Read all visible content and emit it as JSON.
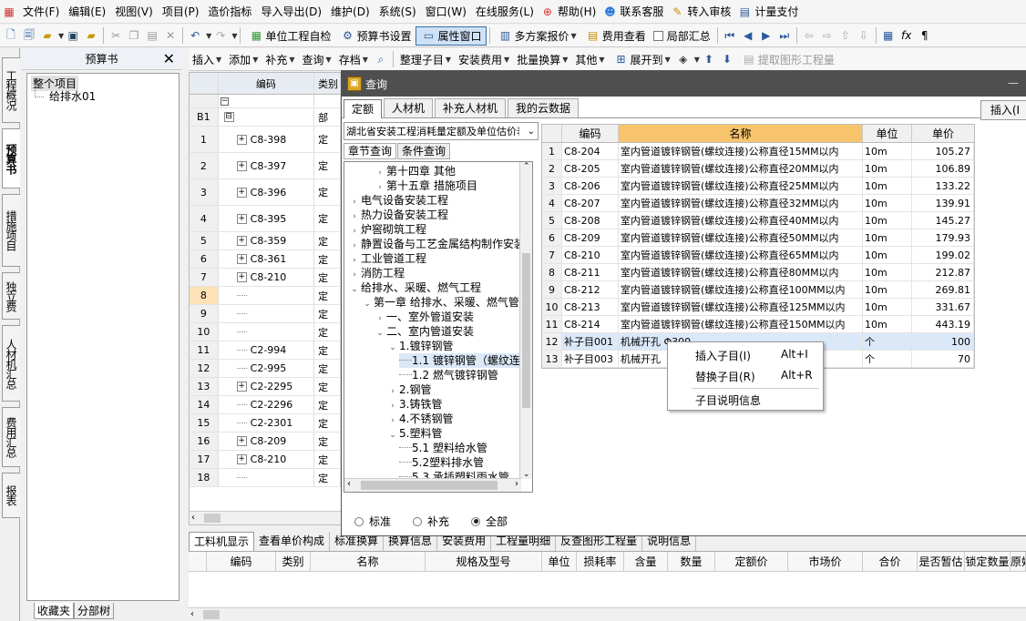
{
  "menu": [
    "文件(F)",
    "编辑(E)",
    "视图(V)",
    "项目(P)",
    "造价指标",
    "导入导出(D)",
    "维护(D)",
    "系统(S)",
    "窗口(W)",
    "在线服务(L)",
    "帮助(H)",
    "联系客服",
    "转入审核",
    "计量支付"
  ],
  "toolbar1": {
    "self_check": "单位工程自检",
    "budget_settings": "预算书设置",
    "property_window": "属性窗口",
    "multi_quote": "多方案报价",
    "fee_view": "费用查看",
    "local_summary": "局部汇总"
  },
  "toolbar2": [
    "插入",
    "添加",
    "补充",
    "查询",
    "存档",
    "整理子目",
    "安装费用",
    "批量换算",
    "其他",
    "展开到",
    "提取图形工程量"
  ],
  "left_tabs": [
    "工程概况",
    "预算书",
    "措施项目",
    "独立费",
    "人材机汇总",
    "费用汇总",
    "报表"
  ],
  "budget_panel": {
    "title": "预算书",
    "close": "✕",
    "root": "整个项目",
    "child": "给排水01",
    "bottom_tabs": [
      "收藏夹",
      "分部树"
    ]
  },
  "grid": {
    "col_code": "编码",
    "col_type": "类别",
    "rows": [
      {
        "no": "B1",
        "exp": "⊟",
        "code": "",
        "type": "部"
      },
      {
        "no": "1",
        "exp": "+",
        "code": "C8-398",
        "type": "定"
      },
      {
        "no": "2",
        "exp": "+",
        "code": "C8-397",
        "type": "定"
      },
      {
        "no": "3",
        "exp": "+",
        "code": "C8-396",
        "type": "定"
      },
      {
        "no": "4",
        "exp": "+",
        "code": "C8-395",
        "type": "定"
      },
      {
        "no": "5",
        "exp": "+",
        "code": "C8-359",
        "type": "定"
      },
      {
        "no": "6",
        "exp": "+",
        "code": "C8-361",
        "type": "定"
      },
      {
        "no": "7",
        "exp": "+",
        "code": "C8-210",
        "type": "定"
      },
      {
        "no": "8",
        "exp": "",
        "code": "",
        "type": "定"
      },
      {
        "no": "9",
        "exp": "",
        "code": "",
        "type": "定"
      },
      {
        "no": "10",
        "exp": "",
        "code": "",
        "type": "定"
      },
      {
        "no": "11",
        "exp": "",
        "code": "C2-994",
        "type": "定"
      },
      {
        "no": "12",
        "exp": "",
        "code": "C2-995",
        "type": "定"
      },
      {
        "no": "13",
        "exp": "+",
        "code": "C2-2295",
        "type": "定"
      },
      {
        "no": "14",
        "exp": "",
        "code": "C2-2296",
        "type": "定"
      },
      {
        "no": "15",
        "exp": "",
        "code": "C2-2301",
        "type": "定"
      },
      {
        "no": "16",
        "exp": "+",
        "code": "C8-209",
        "type": "定"
      },
      {
        "no": "17",
        "exp": "+",
        "code": "C8-210",
        "type": "定"
      },
      {
        "no": "18",
        "exp": "",
        "code": "",
        "type": "定"
      }
    ]
  },
  "bottom_panel": {
    "tabs": [
      "工料机显示",
      "查看单价构成",
      "标准换算",
      "换算信息",
      "安装费用",
      "工程量明细",
      "反查图形工程量",
      "说明信息"
    ],
    "columns": [
      "编码",
      "类别",
      "名称",
      "规格及型号",
      "单位",
      "损耗率",
      "含量",
      "数量",
      "定额价",
      "市场价",
      "合价",
      "是否暂估",
      "锁定数量",
      "原始"
    ]
  },
  "dialog": {
    "title": "查询",
    "tabs": [
      "定额",
      "人材机",
      "补充人材机",
      "我的云数据"
    ],
    "insert_button": "插入(I",
    "quota_lib": "湖北省安装工程消耗量定额及单位估价表",
    "left_tabs": [
      "章节查询",
      "条件查询"
    ],
    "tree": [
      {
        "level": 2,
        "toggle": "›",
        "label": "第十四章 其他"
      },
      {
        "level": 2,
        "toggle": "›",
        "label": "第十五章 措施项目"
      },
      {
        "level": 0,
        "toggle": "›",
        "label": "电气设备安装工程"
      },
      {
        "level": 0,
        "toggle": "›",
        "label": "热力设备安装工程"
      },
      {
        "level": 0,
        "toggle": "›",
        "label": "炉窖砌筑工程"
      },
      {
        "level": 0,
        "toggle": "›",
        "label": "静置设备与工艺金属结构制作安装"
      },
      {
        "level": 0,
        "toggle": "›",
        "label": "工业管道工程"
      },
      {
        "level": 0,
        "toggle": "›",
        "label": "消防工程"
      },
      {
        "level": 0,
        "toggle": "⌄",
        "label": "给排水、采暖、燃气工程"
      },
      {
        "level": 1,
        "toggle": "⌄",
        "label": "第一章 给排水、采暖、燃气管道"
      },
      {
        "level": 2,
        "toggle": "›",
        "label": "一、室外管道安装"
      },
      {
        "level": 2,
        "toggle": "⌄",
        "label": "二、室内管道安装"
      },
      {
        "level": 3,
        "toggle": "⌄",
        "label": "1.镀锌钢管"
      },
      {
        "level": 4,
        "toggle": "",
        "label": "1.1 镀锌钢管（螺纹连接）"
      },
      {
        "level": 4,
        "toggle": "",
        "label": "1.2 燃气镀锌钢管"
      },
      {
        "level": 3,
        "toggle": "›",
        "label": "2.钢管"
      },
      {
        "level": 3,
        "toggle": "›",
        "label": "3.铸铁管"
      },
      {
        "level": 3,
        "toggle": "›",
        "label": "4.不锈钢管"
      },
      {
        "level": 3,
        "toggle": "⌄",
        "label": "5.塑料管"
      },
      {
        "level": 4,
        "toggle": "",
        "label": "5.1 塑料给水管"
      },
      {
        "level": 4,
        "toggle": "",
        "label": "5.2塑料排水管"
      },
      {
        "level": 4,
        "toggle": "",
        "label": "5.3 承插塑料雨水管"
      }
    ],
    "radios": [
      "标准",
      "补充",
      "全部"
    ],
    "table": {
      "columns": [
        "编码",
        "名称",
        "单位",
        "单价"
      ],
      "rows": [
        {
          "no": "1",
          "code": "C8-204",
          "name": "室内管道镀锌钢管(螺纹连接)公称直径15MM以内",
          "unit": "10m",
          "price": "105.27"
        },
        {
          "no": "2",
          "code": "C8-205",
          "name": "室内管道镀锌钢管(螺纹连接)公称直径20MM以内",
          "unit": "10m",
          "price": "106.89"
        },
        {
          "no": "3",
          "code": "C8-206",
          "name": "室内管道镀锌钢管(螺纹连接)公称直径25MM以内",
          "unit": "10m",
          "price": "133.22"
        },
        {
          "no": "4",
          "code": "C8-207",
          "name": "室内管道镀锌钢管(螺纹连接)公称直径32MM以内",
          "unit": "10m",
          "price": "139.91"
        },
        {
          "no": "5",
          "code": "C8-208",
          "name": "室内管道镀锌钢管(螺纹连接)公称直径40MM以内",
          "unit": "10m",
          "price": "145.27"
        },
        {
          "no": "6",
          "code": "C8-209",
          "name": "室内管道镀锌钢管(螺纹连接)公称直径50MM以内",
          "unit": "10m",
          "price": "179.93"
        },
        {
          "no": "7",
          "code": "C8-210",
          "name": "室内管道镀锌钢管(螺纹连接)公称直径65MM以内",
          "unit": "10m",
          "price": "199.02"
        },
        {
          "no": "8",
          "code": "C8-211",
          "name": "室内管道镀锌钢管(螺纹连接)公称直径80MM以内",
          "unit": "10m",
          "price": "212.87"
        },
        {
          "no": "9",
          "code": "C8-212",
          "name": "室内管道镀锌钢管(螺纹连接)公称直径100MM以内",
          "unit": "10m",
          "price": "269.81"
        },
        {
          "no": "10",
          "code": "C8-213",
          "name": "室内管道镀锌钢管(螺纹连接)公称直径125MM以内",
          "unit": "10m",
          "price": "331.67"
        },
        {
          "no": "11",
          "code": "C8-214",
          "name": "室内管道镀锌钢管(螺纹连接)公称直径150MM以内",
          "unit": "10m",
          "price": "443.19"
        },
        {
          "no": "12",
          "code": "补子目001",
          "name": "机械开孔 Φ300",
          "unit": "个",
          "price": "100"
        },
        {
          "no": "13",
          "code": "补子目003",
          "name": "机械开孔",
          "unit": "个",
          "price": "70"
        }
      ]
    }
  },
  "context_menu": [
    {
      "label": "插入子目(I)",
      "key": "Alt+I"
    },
    {
      "label": "替换子目(R)",
      "key": "Alt+R"
    },
    {
      "label": "子目说明信息",
      "key": ""
    }
  ]
}
